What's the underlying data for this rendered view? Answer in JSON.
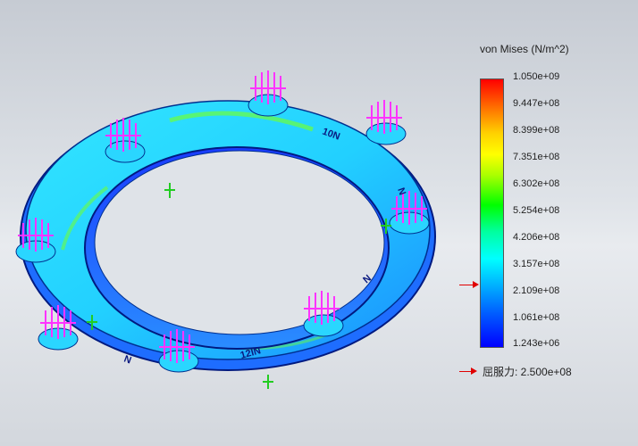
{
  "legend": {
    "title": "von Mises (N/m^2)",
    "ticks": [
      "1.050e+09",
      "9.447e+08",
      "8.399e+08",
      "7.351e+08",
      "6.302e+08",
      "5.254e+08",
      "4.206e+08",
      "3.157e+08",
      "2.109e+08",
      "1.061e+08",
      "1.243e+06"
    ],
    "yield_label": "屈服力: 2.500e+08"
  },
  "model": {
    "labels": [
      "10N",
      "12IN",
      "N",
      "N",
      "N"
    ]
  },
  "colors": {
    "load_arrows": "#ff33ff",
    "fixture_arrows": "#22cc22",
    "pointer": "#e00000"
  }
}
